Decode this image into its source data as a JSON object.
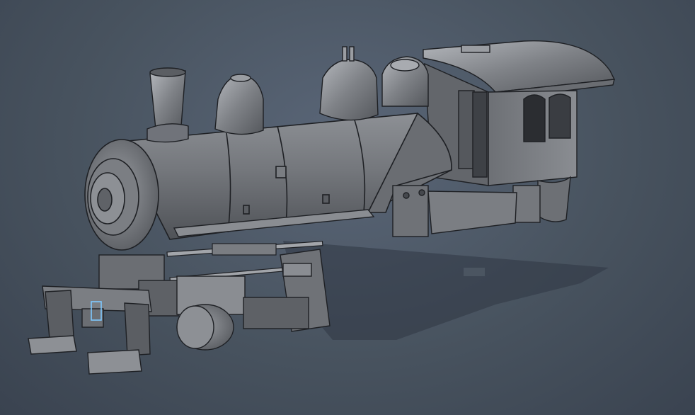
{
  "viewport": {
    "background_top": "#5a6678",
    "background_bottom": "#3a4350",
    "model_color": "#7d7f84",
    "edge_color": "#1e2024",
    "shadow_color": "#2f3744",
    "selection_color": "#7ec8ff"
  },
  "model": {
    "parts": [
      "boiler",
      "smokebox-front",
      "smokestack",
      "sand-dome",
      "steam-dome",
      "cab",
      "cab-roof",
      "running-board",
      "chassis-frame",
      "pilot",
      "cylinder",
      "side-rods"
    ]
  }
}
